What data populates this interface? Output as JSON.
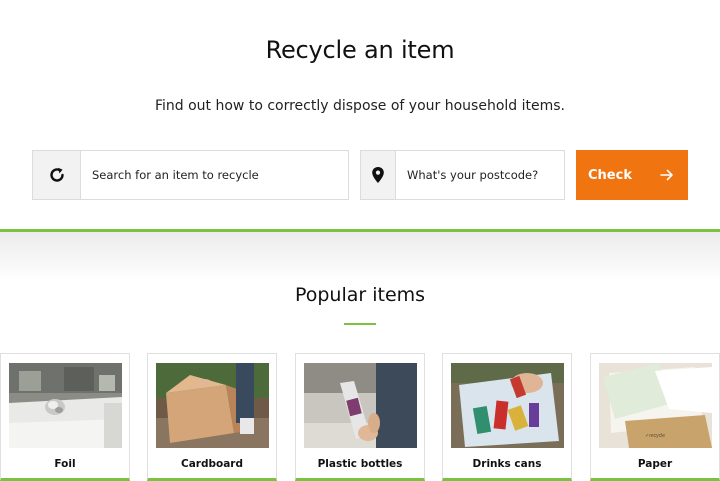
{
  "hero": {
    "title": "Recycle an item",
    "subtitle": "Find out how to correctly dispose of your household items."
  },
  "search": {
    "item_placeholder": "Search for an item to recycle",
    "postcode_placeholder": "What's your postcode?",
    "check_label": "Check",
    "icons": [
      "recycle-icon",
      "location-pin-icon",
      "arrow-right-icon"
    ]
  },
  "popular": {
    "title": "Popular items",
    "items": [
      {
        "label": "Foil"
      },
      {
        "label": "Cardboard"
      },
      {
        "label": "Plastic bottles"
      },
      {
        "label": "Drinks cans"
      },
      {
        "label": "Paper"
      }
    ]
  },
  "colors": {
    "accent_orange": "#f07410",
    "accent_green": "#7cc242",
    "text": "#111111"
  }
}
